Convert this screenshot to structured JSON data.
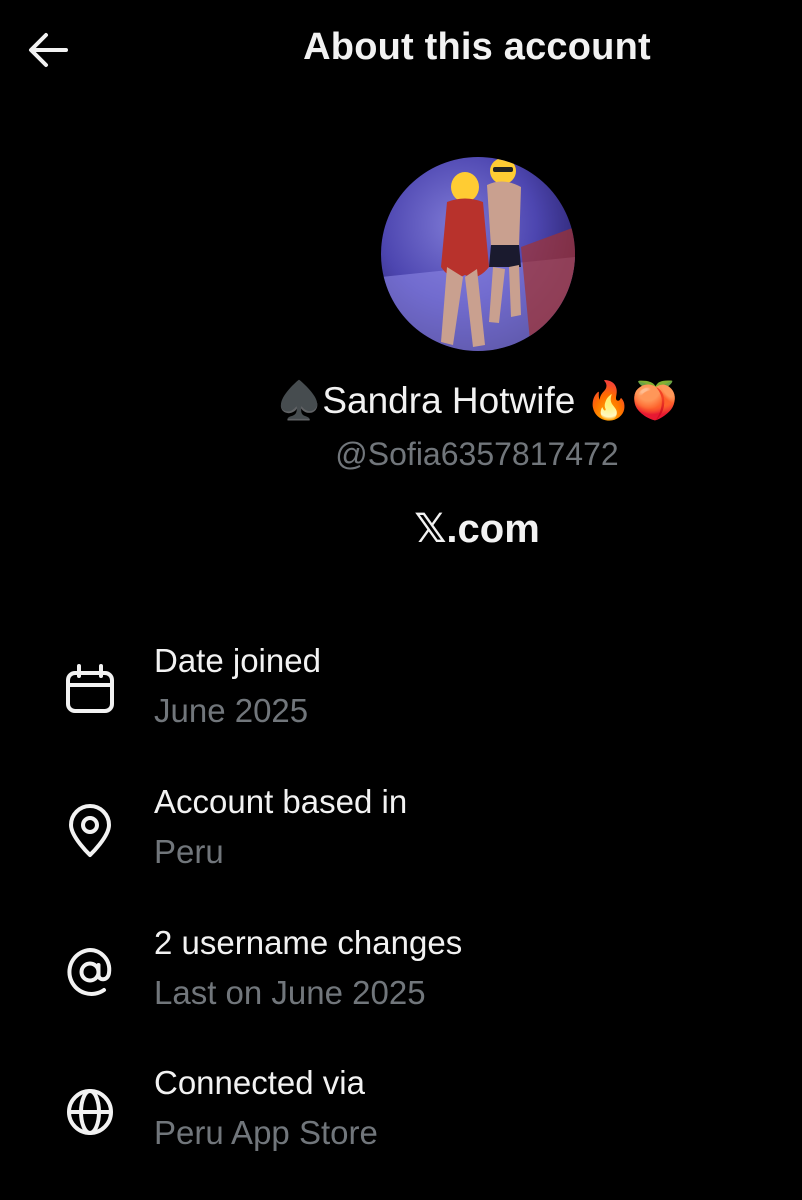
{
  "header": {
    "title": "About this account",
    "back_icon": "arrow-left-icon"
  },
  "profile": {
    "display_name": "♠️Sandra Hotwife 🔥🍑",
    "handle": "@Sofia6357817472",
    "site": "𝕏.com",
    "avatar": "profile-photo"
  },
  "info_rows": [
    {
      "icon": "calendar-icon",
      "label": "Date joined",
      "value": "June 2025"
    },
    {
      "icon": "location-pin-icon",
      "label": "Account based in",
      "value": "Peru"
    },
    {
      "icon": "at-sign-icon",
      "label": "2 username changes",
      "value": "Last on June 2025"
    },
    {
      "icon": "globe-icon",
      "label": "Connected via",
      "value": "Peru App Store"
    }
  ],
  "colors": {
    "background": "#000000",
    "primary_text": "#f2f2f2",
    "secondary_text": "#71767b"
  }
}
